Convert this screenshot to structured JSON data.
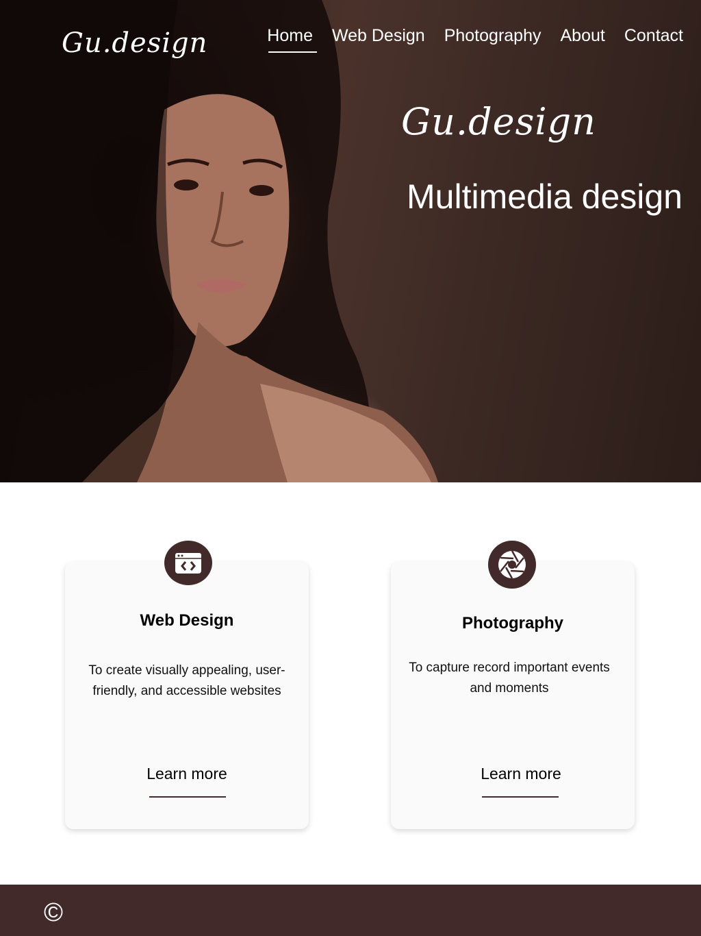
{
  "header": {
    "logo": "Gu.design",
    "nav": [
      {
        "label": "Home",
        "active": true
      },
      {
        "label": "Web Design",
        "active": false
      },
      {
        "label": "Photography",
        "active": false
      },
      {
        "label": "About",
        "active": false
      },
      {
        "label": "Contact",
        "active": false
      }
    ]
  },
  "hero": {
    "logo": "Gu.design",
    "subtitle": "Multimedia design"
  },
  "cards": [
    {
      "icon": "code-window-icon",
      "title": "Web Design",
      "description": "To create visually appealing, user-friendly, and accessible websites",
      "link": "Learn more"
    },
    {
      "icon": "camera-aperture-icon",
      "title": "Photography",
      "description": "To capture record important events and moments",
      "link": "Learn more"
    }
  ],
  "footer": {
    "copyright": "©"
  },
  "colors": {
    "brand": "#42292a",
    "card_bg": "#fafafa",
    "text": "#000000"
  }
}
